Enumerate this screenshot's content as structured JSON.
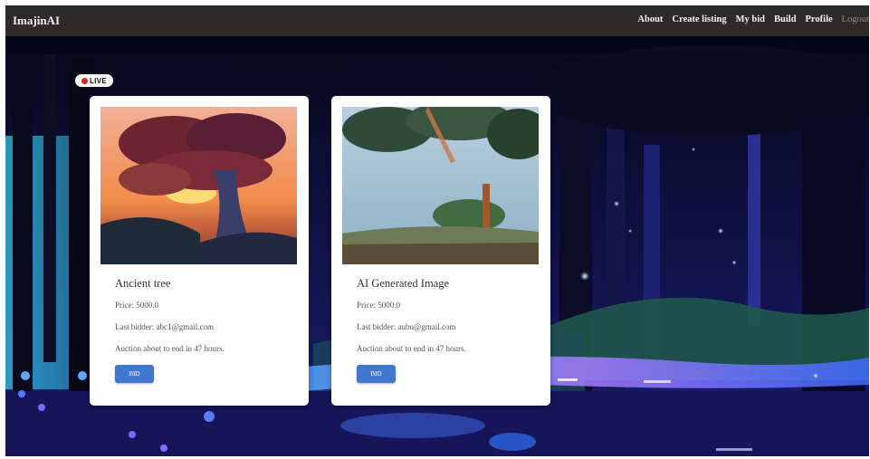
{
  "app": {
    "brand": "ImajinAI"
  },
  "nav": {
    "about": "About",
    "create_listing": "Create listing",
    "my_bid": "My bid",
    "build": "Build",
    "profile": "Profile",
    "logout": "Logout"
  },
  "live_badge": "LIVE",
  "listings": [
    {
      "title": "Ancient tree",
      "price": "Price: 5000.0",
      "last_bidder": "Last bidder: abc1@gmail.com",
      "auction_status": "Auction about to end in 47 hours.",
      "bid_label": "BID"
    },
    {
      "title": "AI Generated Image",
      "price": "Price: 5000.0",
      "last_bidder": "Last bidder: aubu@gmail.com",
      "auction_status": "Auction about to end in 47 hours.",
      "bid_label": "BID"
    }
  ],
  "colors": {
    "navbar": "#2e2a29",
    "bid_button": "#3f77d1",
    "live_dot": "#e11d1d"
  }
}
